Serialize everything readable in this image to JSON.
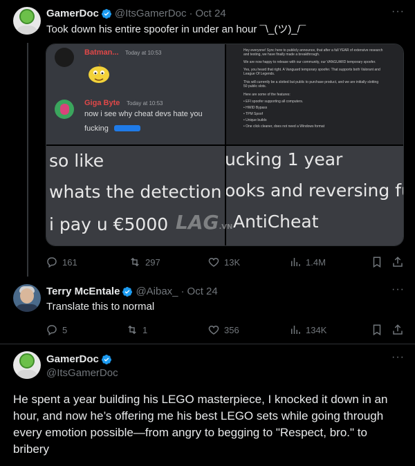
{
  "tweet1": {
    "name": "GamerDoc",
    "handle": "@ItsGamerDoc",
    "sep": "·",
    "date": "Oct 24",
    "text": "Took down his entire spoofer in under an hour ¯\\_(ツ)_/¯",
    "stats": {
      "replies": "161",
      "retweets": "297",
      "likes": "13K",
      "views": "1.4M"
    }
  },
  "media": {
    "discord": {
      "msg1_name": "Batman...",
      "msg1_time": "Today at 10:53",
      "msg2_name": "Giga Byte",
      "msg2_time": "Today at 10:53",
      "msg2_line1": "now i see why cheat devs hate you",
      "msg2_line2": "fucking"
    },
    "doc_lines": [
      "Hey everyone! Sync here to publicly announce, that after a full YEAR of extensive research",
      "and testing, we have finally made a breakthrough.",
      "We are now happy to release with our community, our VANGUARD temporary spoofer.",
      "Yes, you heard that right. A Vanguard temporary spoofer. That supports both Valorant and",
      "League Of Legends.",
      "This will currently be a slotted but public to purchase product, and we are initially slotting",
      "50 public slots.",
      "Here are some of the features:",
      "• EFI spoofer supporting all computers.",
      "• HWID Bypass",
      "• TPM Spoof",
      "• Unique builds",
      "• One click cleaner, does not need a Windows format"
    ],
    "left_lines": [
      "so like",
      "whats the detection",
      "i pay u €5000"
    ],
    "right_lines": [
      "ucking 1 year",
      "ooks and reversing fuc",
      "AntiCheat"
    ],
    "watermark": "LAG",
    "watermark_suffix": ".VN"
  },
  "tweet2": {
    "name": "Terry McEntale",
    "handle": "@Aibax_",
    "sep": "·",
    "date": "Oct 24",
    "text": "Translate this to normal",
    "stats": {
      "replies": "5",
      "retweets": "1",
      "likes": "356",
      "views": "134K"
    }
  },
  "tweet3": {
    "name": "GamerDoc",
    "handle": "@ItsGamerDoc",
    "text": "He spent a year building his LEGO masterpiece, I knocked it down in an hour, and now he’s offering me his best LEGO sets while going through every emotion possible—from angry to begging to \"Respect, bro.\" to bribery"
  },
  "colors": {
    "verified": "#1d9bf0",
    "muted": "#71767b",
    "divider": "#2f3336",
    "bg": "#000000"
  }
}
